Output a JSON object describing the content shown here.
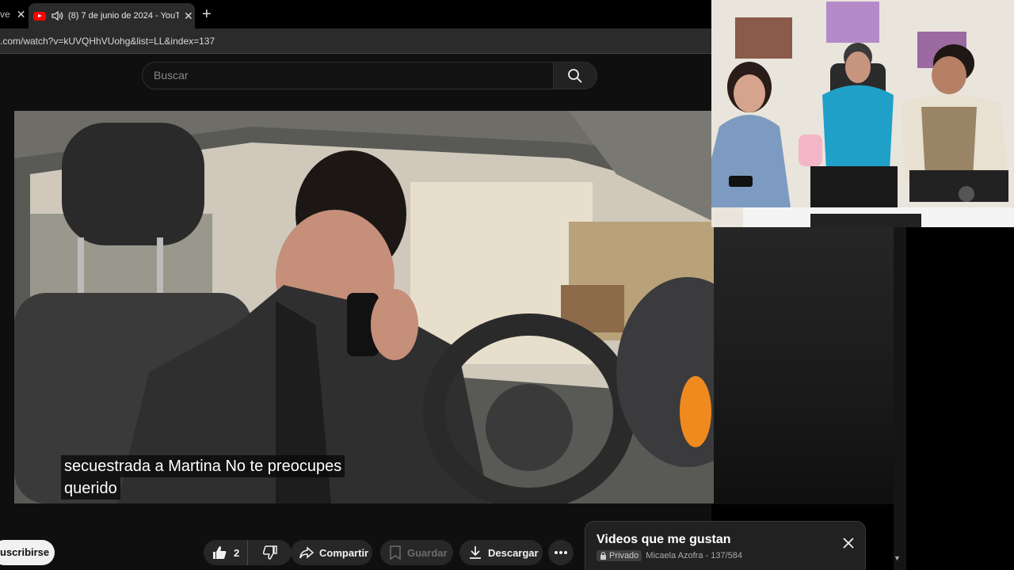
{
  "browser": {
    "prev_tab_fragment": "ve",
    "active_tab_title": "(8) 7 de junio de 2024 - YouTu",
    "url": ".com/watch?v=kUVQHhVUohg&list=LL&index=137"
  },
  "search": {
    "placeholder": "Buscar"
  },
  "video": {
    "caption_line_1": "secuestrada a Martina No te preocupes",
    "caption_line_2": "querido"
  },
  "actions": {
    "subscribe_label": "uscribirse",
    "like_count": "2",
    "share_label": "Compartir",
    "save_label": "Guardar",
    "download_label": "Descargar"
  },
  "playlist": {
    "title": "Videos que me gustan",
    "privacy_label": "Privado",
    "owner_and_position": "Micaela Azofra - 137/584"
  },
  "icons": {
    "youtube_favicon": "youtube-favicon-icon",
    "speaker": "speaker-icon",
    "search": "search-icon",
    "like": "thumbs-up-icon",
    "dislike": "thumbs-down-icon",
    "share": "share-icon",
    "save": "bookmark-icon",
    "download": "download-icon",
    "more": "more-horizontal-icon",
    "lock": "lock-icon",
    "close": "close-icon"
  },
  "colors": {
    "youtube_red": "#ff0000",
    "page_bg": "#0f0f0f",
    "pill_bg": "#272727"
  }
}
